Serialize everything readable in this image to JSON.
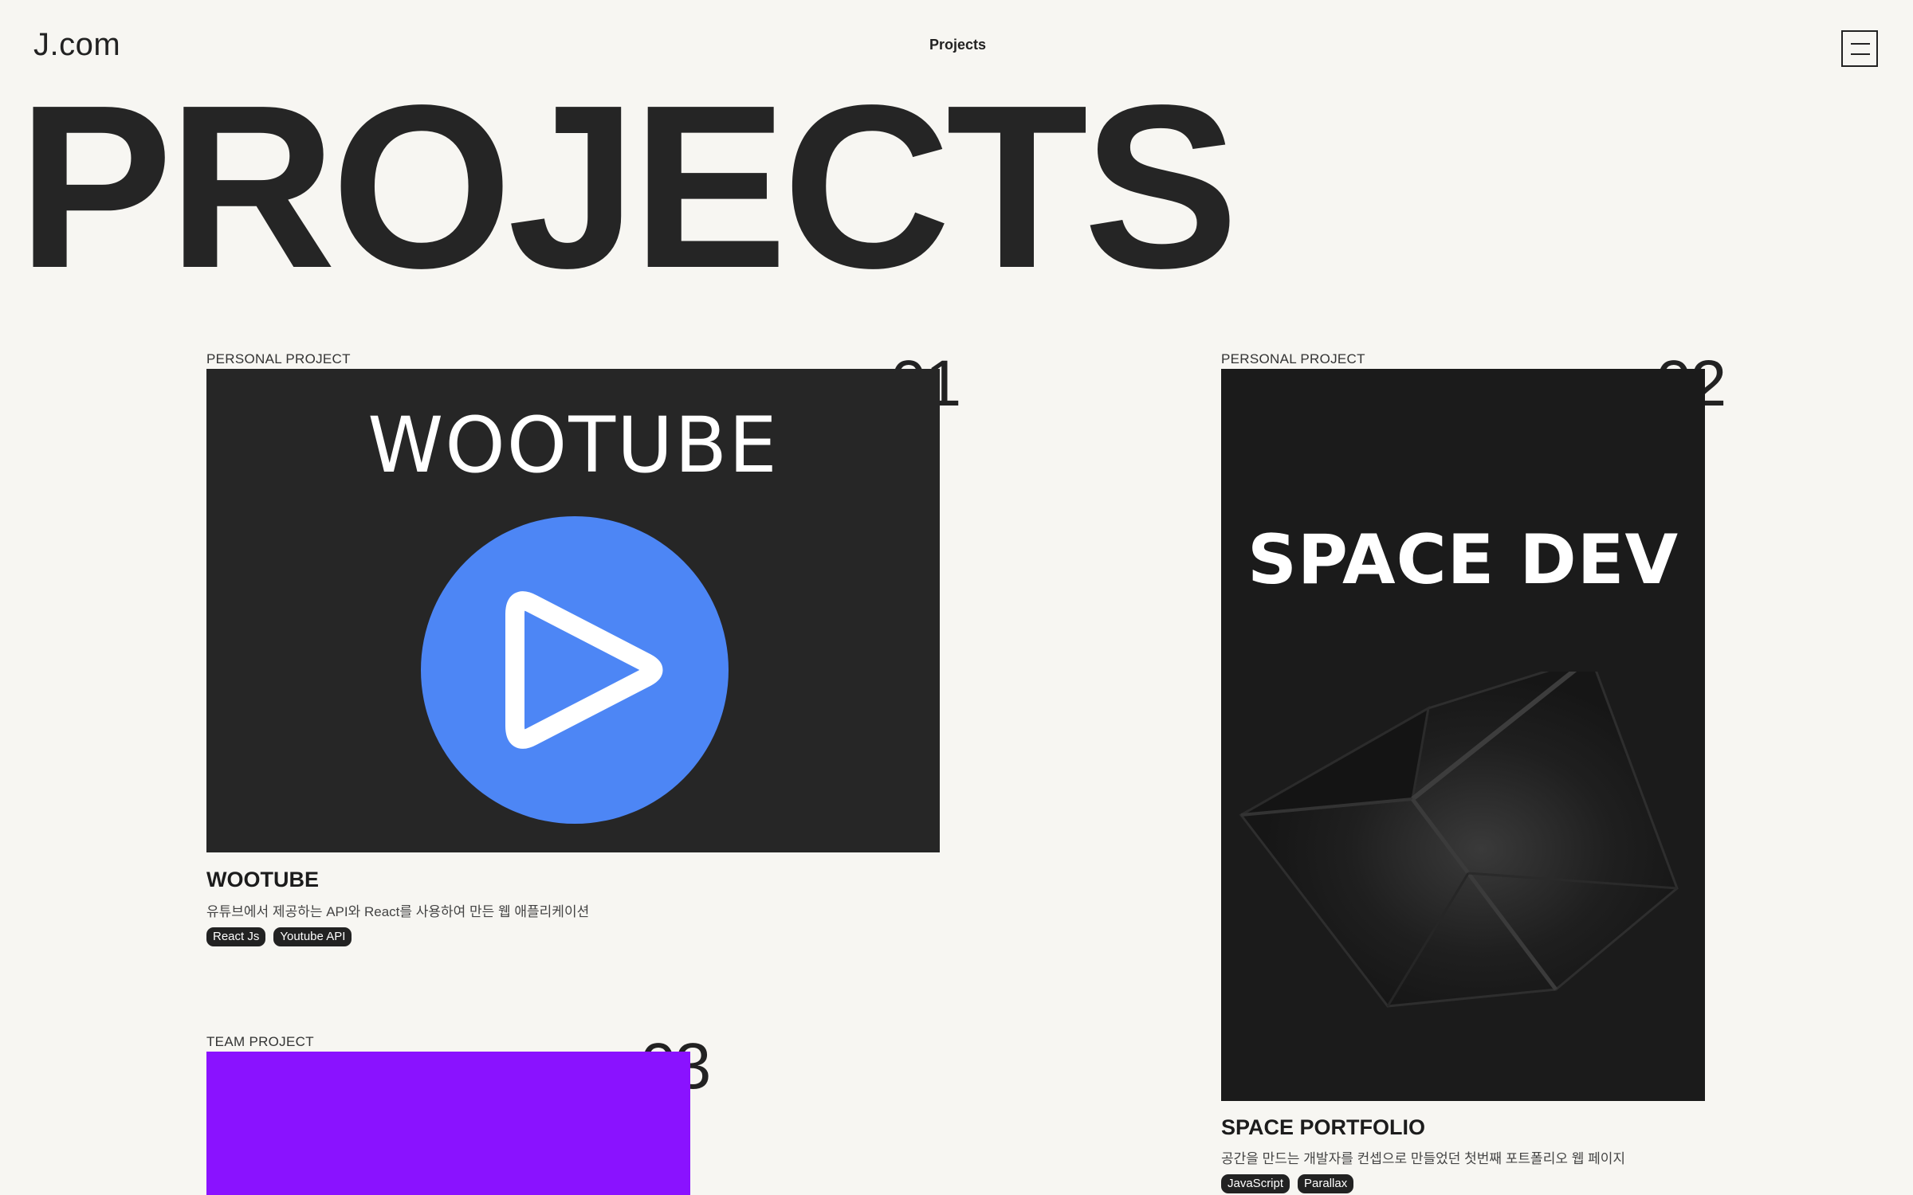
{
  "header": {
    "logo": "J.com",
    "nav_label": "Projects",
    "menu_icon": "hamburger-menu-icon"
  },
  "hero": {
    "title": "PROJECTS"
  },
  "projects": [
    {
      "kind": "PERSONAL PROJECT",
      "number": "01",
      "thumb_title": "WOOTUBE",
      "thumb_icon": "play-button-icon",
      "thumb_bg": "#262626",
      "accent": "#4d86f5",
      "name": "WOOTUBE",
      "description": "유튜브에서 제공하는 API와 React를 사용하여 만든 웹 애플리케이션",
      "tags": [
        "React Js",
        "Youtube API"
      ]
    },
    {
      "kind": "PERSONAL PROJECT",
      "number": "02",
      "thumb_title": "SPACE DEV",
      "thumb_icon": "cube-icon",
      "thumb_bg": "#1b1b1b",
      "name": "SPACE PORTFOLIO",
      "description": "공간을 만드는 개발자를 컨셉으로 만들었던 첫번째 포트폴리오 웹 페이지",
      "tags": [
        "JavaScript",
        "Parallax"
      ]
    },
    {
      "kind": "TEAM PROJECT",
      "number": "03",
      "thumb_bg": "#8a12ff"
    }
  ]
}
